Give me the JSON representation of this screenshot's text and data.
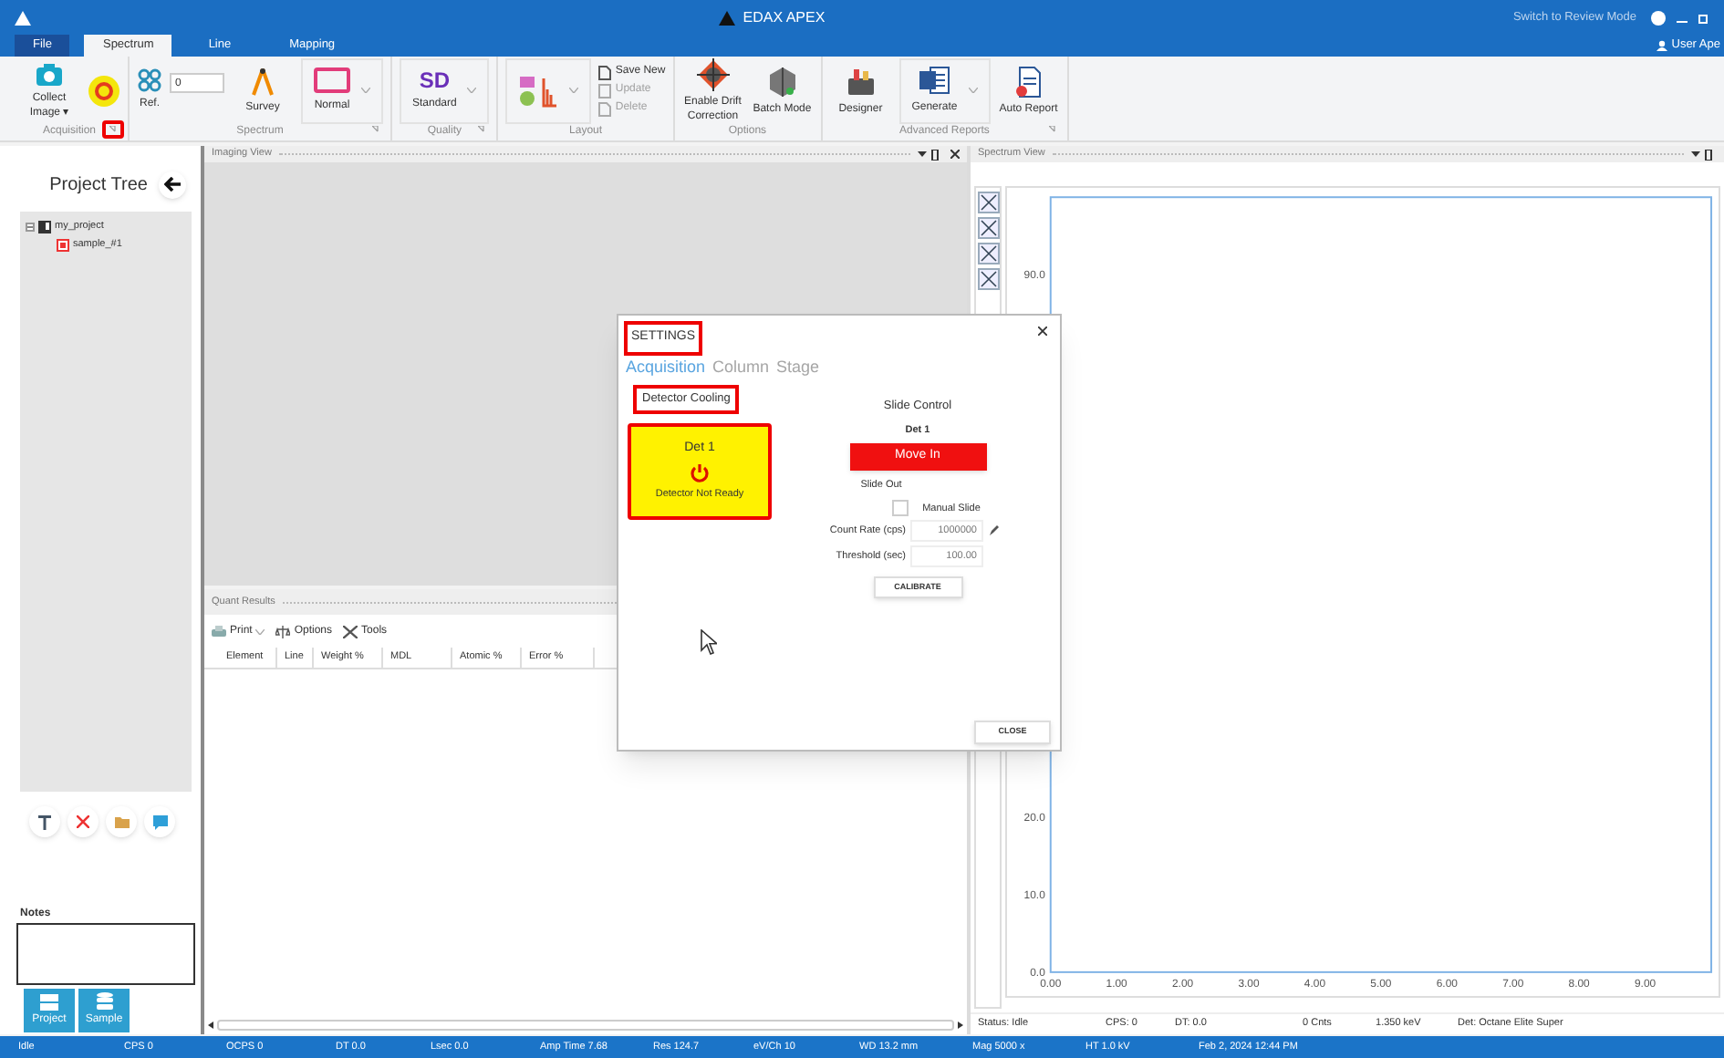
{
  "window": {
    "title": "EDAX APEX",
    "review_mode": "Switch to Review Mode",
    "user": "User Ape"
  },
  "tabs": [
    {
      "label": "File",
      "selected": false,
      "kind": "menu"
    },
    {
      "label": "Spectrum",
      "selected": true,
      "kind": "tab"
    },
    {
      "label": "Line",
      "selected": false,
      "kind": "tab"
    },
    {
      "label": "Mapping",
      "selected": false,
      "kind": "tab"
    }
  ],
  "ribbon": {
    "groups": [
      {
        "label": "Acquisition",
        "launcher": {
          "highlighted": true
        },
        "items": [
          {
            "kind": "large",
            "label": "Collect Image ▾"
          },
          {
            "kind": "icon"
          }
        ]
      },
      {
        "label": "Spectrum",
        "launcher": {
          "highlighted": false
        },
        "items": [
          {
            "kind": "field",
            "label": "Ref.",
            "value": "0"
          },
          {
            "kind": "large",
            "label": "Survey"
          },
          {
            "kind": "dropdown",
            "label": "Normal"
          }
        ]
      },
      {
        "label": "Quality",
        "launcher": {
          "highlighted": false
        },
        "items": [
          {
            "kind": "dropdown",
            "badge": "SD",
            "label": "Standard"
          }
        ]
      },
      {
        "label": "Layout",
        "items": [
          {
            "kind": "dropdown"
          },
          {
            "kind": "stack",
            "entries": [
              {
                "label": "Save New",
                "disabled": false
              },
              {
                "label": "Update",
                "disabled": true
              },
              {
                "label": "Delete",
                "disabled": true
              }
            ]
          }
        ]
      },
      {
        "label": "Options",
        "items": [
          {
            "kind": "large",
            "label": "Enable Drift Correction"
          },
          {
            "kind": "large",
            "label": "Batch Mode"
          }
        ]
      },
      {
        "label": "Advanced Reports",
        "launcher": {
          "highlighted": false
        },
        "items": [
          {
            "kind": "large",
            "label": "Designer"
          },
          {
            "kind": "dropdown",
            "label": "Generate"
          },
          {
            "kind": "large",
            "label": "Auto Report"
          }
        ]
      }
    ]
  },
  "project_tree": {
    "title": "Project Tree",
    "items": [
      {
        "label": "my_project",
        "expanded": true,
        "children": [
          {
            "label": "sample_#1"
          }
        ]
      }
    ]
  },
  "notes": {
    "label": "Notes"
  },
  "bottom_buttons": [
    "Project",
    "Sample"
  ],
  "imaging_view": {
    "title": "Imaging View"
  },
  "quant_results": {
    "title": "Quant Results",
    "toolbar": [
      "Print",
      "Options",
      "Tools"
    ],
    "columns": [
      "Element",
      "Line",
      "Weight %",
      "MDL",
      "Atomic %",
      "Error %"
    ]
  },
  "spectrum_view": {
    "title": "Spectrum View",
    "chart_data": {
      "type": "line",
      "xlim": [
        0,
        10
      ],
      "ylim": [
        0,
        100
      ],
      "xticks": [
        {
          "value": 0,
          "label": "0.00"
        },
        {
          "value": 1,
          "label": "1.00"
        },
        {
          "value": 2,
          "label": "2.00"
        },
        {
          "value": 3,
          "label": "3.00"
        },
        {
          "value": 4,
          "label": "4.00"
        },
        {
          "value": 5,
          "label": "5.00"
        },
        {
          "value": 6,
          "label": "6.00"
        },
        {
          "value": 7,
          "label": "7.00"
        },
        {
          "value": 8,
          "label": "8.00"
        },
        {
          "value": 9,
          "label": "9.00"
        }
      ],
      "yticks": [
        {
          "value": 0,
          "label": "0.0"
        },
        {
          "value": 10,
          "label": "10.0"
        },
        {
          "value": 20,
          "label": "20.0"
        },
        {
          "value": 90,
          "label": "90.0"
        }
      ]
    },
    "status": [
      "Status: Idle",
      "CPS: 0",
      "DT: 0.0",
      "0 Cnts",
      "1.350 keV",
      "Det: Octane Elite Super"
    ]
  },
  "status_bar": [
    "Idle",
    "CPS 0",
    "OCPS 0",
    "DT 0.0",
    "Lsec 0.0",
    "Amp Time 7.68",
    "Res 124.7",
    "eV/Ch 10",
    "WD 13.2 mm",
    "Mag 5000 x",
    "HT 1.0 kV",
    "Feb 2, 2024 12:44 PM"
  ],
  "settings_dialog": {
    "title": "SETTINGS",
    "title_highlighted": true,
    "tabs": [
      {
        "label": "Acquisition",
        "selected": true
      },
      {
        "label": "Column",
        "selected": false
      },
      {
        "label": "Stage",
        "selected": false
      }
    ],
    "cooling": {
      "label": "Detector Cooling",
      "highlighted": true,
      "detector": {
        "name": "Det 1",
        "status": "Detector Not Ready",
        "highlighted": true
      }
    },
    "slide": {
      "title": "Slide Control",
      "detector": "Det 1",
      "button": "Move In",
      "position": "Slide Out",
      "manual_label": "Manual Slide",
      "manual_checked": false
    },
    "fields": [
      {
        "label": "Count Rate (cps)",
        "value": "1000000",
        "editable": true
      },
      {
        "label": "Threshold (sec)",
        "value": "100.00",
        "editable": false
      }
    ],
    "calibrate": "CALIBRATE",
    "close": "CLOSE"
  }
}
